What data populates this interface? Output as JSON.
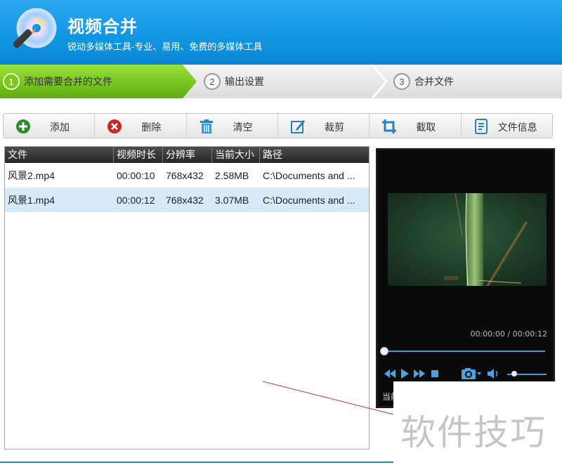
{
  "header": {
    "title": "视频合并",
    "subtitle": "锐动多媒体工具-专业、易用、免费的多媒体工具"
  },
  "steps": [
    {
      "num": "1",
      "label": "添加需要合并的文件",
      "active": true
    },
    {
      "num": "2",
      "label": "输出设置",
      "active": false
    },
    {
      "num": "3",
      "label": "合并文件",
      "active": false
    }
  ],
  "toolbar": {
    "add_label": "添加",
    "delete_label": "删除",
    "clear_label": "清空",
    "crop_label": "裁剪",
    "trim_label": "截取",
    "info_label": "文件信息"
  },
  "file_list": {
    "columns": [
      "文件",
      "视频时长",
      "分辨率",
      "当前大小",
      "路径"
    ],
    "rows": [
      {
        "file": "风景2.mp4",
        "duration": "00:00:10",
        "resolution": "768x432",
        "size": "2.58MB",
        "path": "C:\\Documents and ...",
        "selected": false
      },
      {
        "file": "风景1.mp4",
        "duration": "00:00:12",
        "resolution": "768x432",
        "size": "3.07MB",
        "path": "C:\\Documents and ...",
        "selected": true
      }
    ]
  },
  "player": {
    "timecode": "00:00:00 / 00:00:12",
    "progress": 0,
    "volume": 0.15,
    "current_label": "当前"
  },
  "overlay": {
    "watermark_text": "软件技巧"
  },
  "colors": {
    "header_blue": "#1196e2",
    "step_active_green": "#7dc61a",
    "accent_blue": "#3c9bd6",
    "selected_row": "#d6eaf7"
  }
}
